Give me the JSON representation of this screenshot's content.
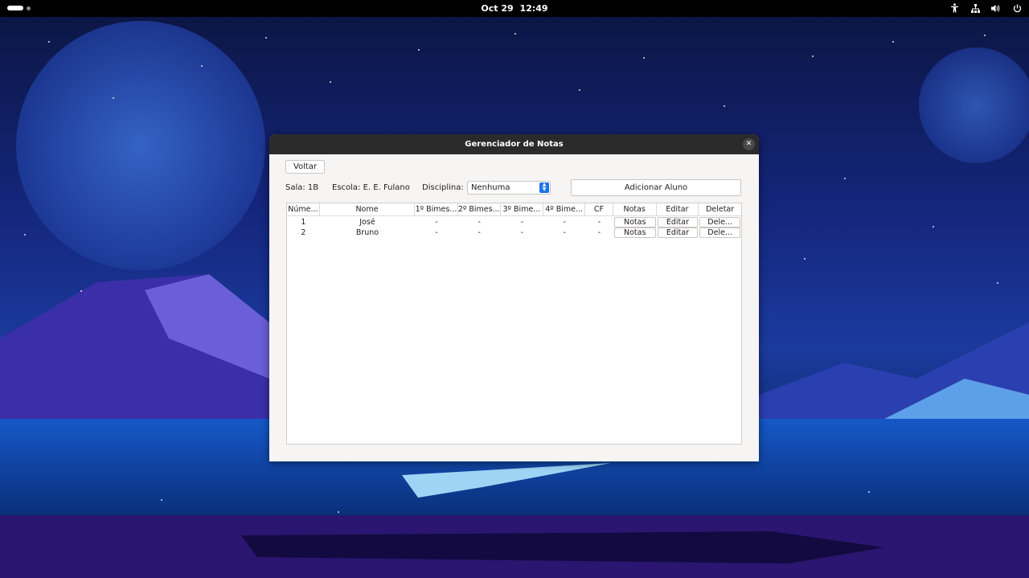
{
  "topbar": {
    "date": "Oct 29",
    "time": "12:49"
  },
  "window": {
    "title": "Gerenciador de Notas",
    "back_label": "Voltar",
    "sala": "Sala: 1B",
    "escola": "Escola: E. E. Fulano",
    "disciplina_label": "Disciplina:",
    "disciplina_value": "Nenhuma",
    "add_label": "Adicionar Aluno"
  },
  "table": {
    "headers": [
      "Núme...",
      "Nome",
      "1º Bimes...",
      "2º Bimes...",
      "3º Bime...",
      "4º Bime...",
      "CF",
      "Notas",
      "Editar",
      "Deletar"
    ],
    "rows": [
      {
        "numero": "1",
        "nome": "José",
        "b1": "-",
        "b2": "-",
        "b3": "-",
        "b4": "-",
        "cf": "-",
        "notas": "Notas",
        "editar": "Editar",
        "deletar": "Dele..."
      },
      {
        "numero": "2",
        "nome": "Bruno",
        "b1": "-",
        "b2": "-",
        "b3": "-",
        "b4": "-",
        "cf": "-",
        "notas": "Notas",
        "editar": "Editar",
        "deletar": "Dele..."
      }
    ]
  },
  "colors": {
    "titlebar": "#2b2b2b",
    "accent": "#1a73e8"
  }
}
